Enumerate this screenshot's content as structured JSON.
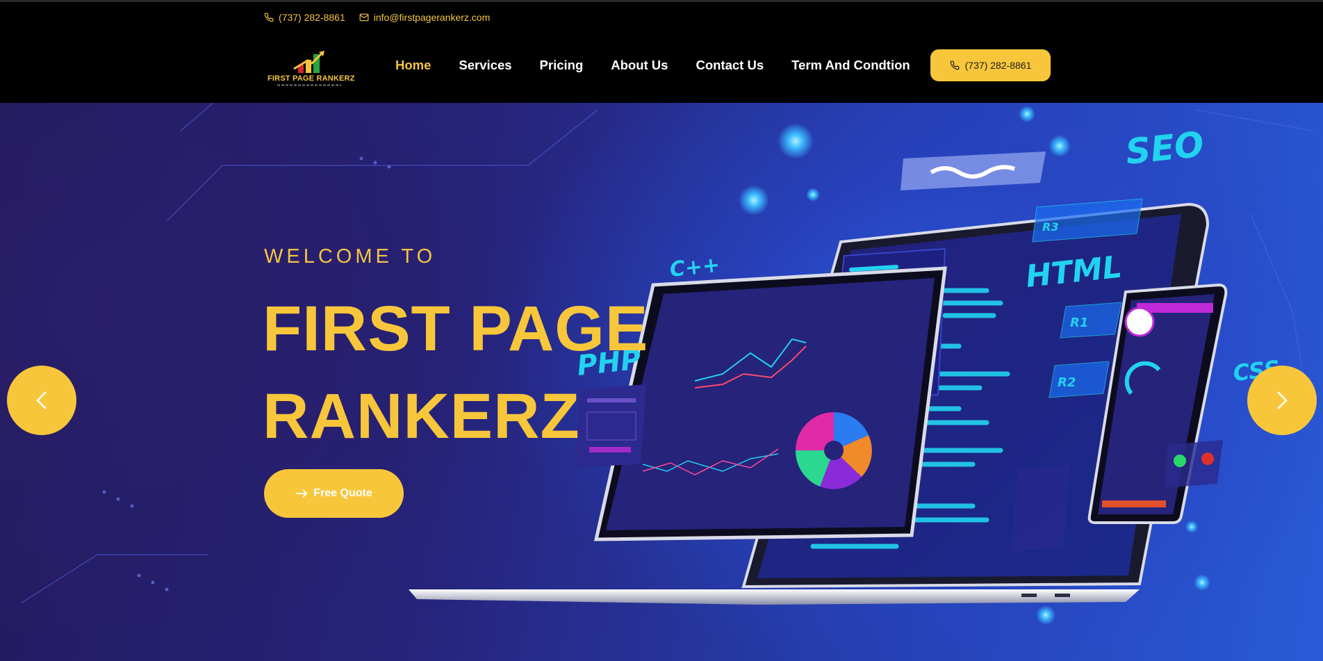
{
  "header": {
    "phone": "(737) 282-8861",
    "email": "info@firstpagerankerz.com",
    "logo_text": "FIRST PAGE RANKERZ",
    "nav": [
      {
        "label": "Home",
        "active": true
      },
      {
        "label": "Services",
        "active": false
      },
      {
        "label": "Pricing",
        "active": false
      },
      {
        "label": "About Us",
        "active": false
      },
      {
        "label": "Contact Us",
        "active": false
      },
      {
        "label": "Term And Condtion",
        "active": false
      }
    ],
    "cta_phone": "(737) 282-8861"
  },
  "hero": {
    "welcome": "WELCOME TO",
    "title_line1": "FIRST PAGE",
    "title_line2": "RANKERZ",
    "cta_label": "Free Quote",
    "art_labels": {
      "seo": "SEO",
      "html": "HTML",
      "cpp": "C++",
      "php": "PHP",
      "css": "CSS",
      "r1": "R1",
      "r2": "R2",
      "r3": "R3"
    }
  },
  "colors": {
    "accent": "#f8c63a",
    "topbar": "#000000",
    "hero_dark": "#241a5c",
    "hero_light": "#2a5ad8",
    "neon": "#22d3f0"
  },
  "icons": {
    "phone": "phone-icon",
    "email": "mail-icon",
    "cta": "arrow-right-icon",
    "prev": "chevron-left-icon",
    "next": "chevron-right-icon"
  }
}
